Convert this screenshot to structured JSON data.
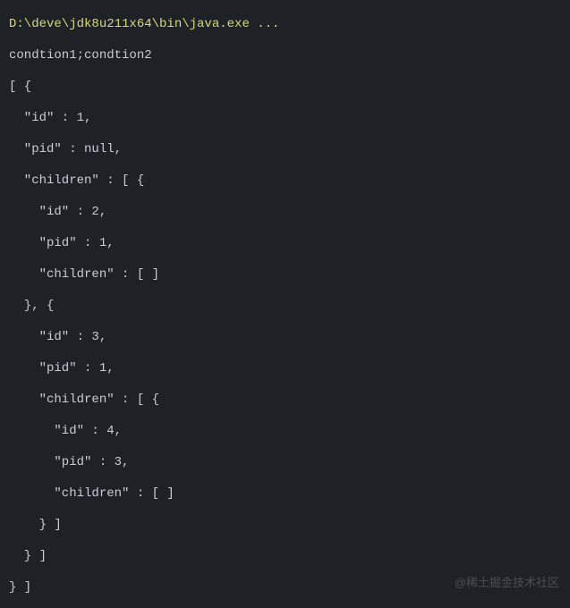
{
  "output": {
    "command": "D:\\deve\\jdk8u211x64\\bin\\java.exe ...",
    "line1": "condtion1;condtion2",
    "lines": [
      "[ {",
      "  \"id\" : 1,",
      "  \"pid\" : null,",
      "  \"children\" : [ {",
      "    \"id\" : 2,",
      "    \"pid\" : 1,",
      "    \"children\" : [ ]",
      "  }, {",
      "    \"id\" : 3,",
      "    \"pid\" : 1,",
      "    \"children\" : [ {",
      "      \"id\" : 4,",
      "      \"pid\" : 3,",
      "      \"children\" : [ ]",
      "    } ]",
      "  } ]",
      "} ]"
    ]
  },
  "watermark": "@稀土掘金技术社区"
}
